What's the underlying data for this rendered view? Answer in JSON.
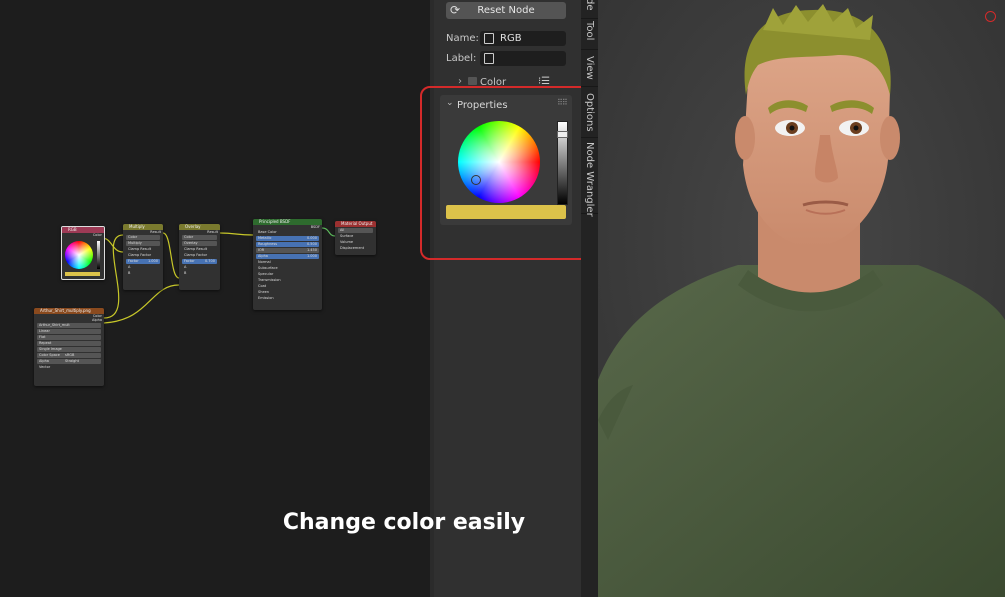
{
  "sidebar": {
    "reset_button": "Reset Node",
    "name_label": "Name:",
    "name_value": "RGB",
    "label_label": "Label:",
    "label_value": "",
    "color_section": "Color",
    "properties_section": "Properties",
    "swatch_color": "#dcc24a"
  },
  "tabs": [
    "de",
    "Tool",
    "View",
    "Options",
    "Node Wrangler"
  ],
  "caption": "Change color easily",
  "nodes": {
    "rgb": "RGB",
    "rgb_out": "Color",
    "mix1": "Multiply",
    "mix1_result": "Result",
    "mix1_mode1": "Color",
    "mix1_mode2": "Multiply",
    "mix1_clamp_result": "Clamp Result",
    "mix1_clamp_factor": "Clamp Factor",
    "mix1_factor": "Factor",
    "mix1_factor_val": "1.000",
    "mix1_a": "A",
    "mix1_b": "B",
    "mix2": "Overlay",
    "mix2_result": "Result",
    "mix2_mode1": "Color",
    "mix2_mode2": "Overlay",
    "mix2_clamp_result": "Clamp Result",
    "mix2_clamp_factor": "Clamp Factor",
    "mix2_factor": "Factor",
    "mix2_factor_val": "0.700",
    "mix2_a": "A",
    "mix2_b": "B",
    "bsdf": "Principled BSDF",
    "bsdf_out": "BSDF",
    "bsdf_base": "Base Color",
    "bsdf_metallic": "Metallic",
    "bsdf_metallic_val": "0.000",
    "bsdf_rough": "Roughness",
    "bsdf_rough_val": "0.500",
    "bsdf_ior": "IOR",
    "bsdf_ior_val": "1.450",
    "bsdf_alpha": "Alpha",
    "bsdf_alpha_val": "1.000",
    "bsdf_normal": "Normal",
    "bsdf_subs": "Subsurface",
    "bsdf_spec": "Specular",
    "bsdf_trans": "Transmission",
    "bsdf_coat": "Coat",
    "bsdf_sheen": "Sheen",
    "bsdf_emis": "Emission",
    "out": "Material Output",
    "out_target": "All",
    "out_surface": "Surface",
    "out_volume": "Volume",
    "out_disp": "Displacement",
    "img": "Arthur_Shirt_multiply.png",
    "img_color": "Color",
    "img_alpha": "Alpha",
    "img_file": "Arthur_Shirt_mult",
    "img_interp": "Linear",
    "img_proj": "Flat",
    "img_ext": "Repeat",
    "img_src": "Single Image",
    "img_cs_label": "Color Space",
    "img_cs": "sRGB",
    "img_alpha_label": "Alpha",
    "img_alpha_mode": "Straight",
    "img_vector": "Vector"
  },
  "colors": {
    "accent_red": "#d42a2a",
    "rgb_header": "#9d3a55",
    "mix_header": "#7a7a2e",
    "bsdf_header": "#2e6b2e",
    "output_header": "#9b3030",
    "image_header": "#8a4a1e",
    "link_yellow": "#c7c729",
    "link_green": "#5fbf5f"
  }
}
